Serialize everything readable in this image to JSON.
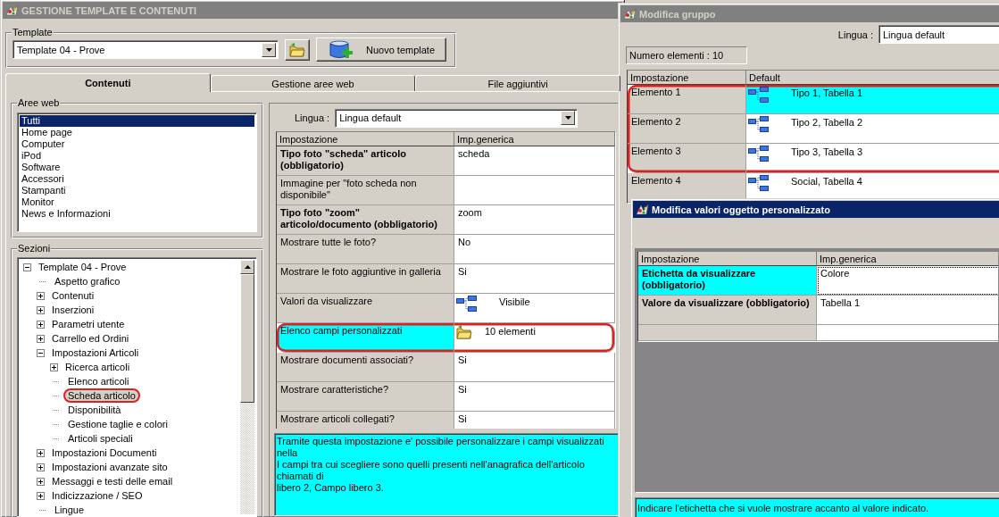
{
  "main_window": {
    "title": "GESTIONE TEMPLATE E CONTENUTI",
    "active": false,
    "template": {
      "label": "Template",
      "value": "Template 04 - Prove"
    },
    "new_template_button": "Nuovo template",
    "tabs": [
      {
        "label": "Contenuti",
        "selected": true
      },
      {
        "label": "Gestione aree web",
        "selected": false
      },
      {
        "label": "File aggiuntivi",
        "selected": false
      }
    ],
    "aree_web": {
      "label": "Aree web",
      "items": [
        {
          "label": "Tutti",
          "selected": true
        },
        {
          "label": "Home page",
          "selected": false
        },
        {
          "label": "Computer",
          "selected": false
        },
        {
          "label": "iPod",
          "selected": false
        },
        {
          "label": "Software",
          "selected": false
        },
        {
          "label": "Accessori",
          "selected": false
        },
        {
          "label": "Stampanti",
          "selected": false
        },
        {
          "label": "Monitor",
          "selected": false
        },
        {
          "label": "News e Informazioni",
          "selected": false
        }
      ]
    },
    "sezioni": {
      "label": "Sezioni",
      "tree": [
        {
          "label": "Template 04 - Prove",
          "kind": "expanded",
          "selected": false,
          "highlighted": false,
          "children": [
            {
              "label": "Aspetto grafico",
              "kind": "leaf",
              "selected": false,
              "highlighted": false
            },
            {
              "label": "Contenuti",
              "kind": "collapsed",
              "selected": false,
              "highlighted": false
            },
            {
              "label": "Inserzioni",
              "kind": "collapsed",
              "selected": false,
              "highlighted": false
            },
            {
              "label": "Parametri utente",
              "kind": "collapsed",
              "selected": false,
              "highlighted": false
            },
            {
              "label": "Carrello ed Ordini",
              "kind": "collapsed",
              "selected": false,
              "highlighted": false
            },
            {
              "label": "Impostazioni Articoli",
              "kind": "expanded",
              "selected": false,
              "highlighted": false,
              "children": [
                {
                  "label": "Ricerca articoli",
                  "kind": "collapsed",
                  "selected": false,
                  "highlighted": false
                },
                {
                  "label": "Elenco articoli",
                  "kind": "leaf",
                  "selected": false,
                  "highlighted": false
                },
                {
                  "label": "Scheda articolo",
                  "kind": "leaf",
                  "selected": true,
                  "highlighted": true
                },
                {
                  "label": "Disponibilità",
                  "kind": "leaf",
                  "selected": false,
                  "highlighted": false
                },
                {
                  "label": "Gestione taglie e colori",
                  "kind": "leaf",
                  "selected": false,
                  "highlighted": false
                },
                {
                  "label": "Articoli speciali",
                  "kind": "leaf",
                  "selected": false,
                  "highlighted": false
                }
              ]
            },
            {
              "label": "Impostazioni Documenti",
              "kind": "collapsed",
              "selected": false,
              "highlighted": false
            },
            {
              "label": "Impostazioni avanzate sito",
              "kind": "collapsed",
              "selected": false,
              "highlighted": false
            },
            {
              "label": "Messaggi e testi delle email",
              "kind": "collapsed",
              "selected": false,
              "highlighted": false
            },
            {
              "label": "Indicizzazione / SEO",
              "kind": "collapsed",
              "selected": false,
              "highlighted": false
            },
            {
              "label": "Lingue",
              "kind": "leaf",
              "selected": false,
              "highlighted": false
            }
          ]
        }
      ]
    },
    "lingua": {
      "label": "Lingua :",
      "value": "Lingua default"
    },
    "settings": {
      "columns": [
        "Impostazione",
        "Imp.generica"
      ],
      "rows": [
        {
          "label": "Tipo foto \"scheda\" articolo (obbligatorio)",
          "bold": true,
          "selected": false,
          "highlighted": false,
          "kind": "text",
          "value": "scheda"
        },
        {
          "label": "Immagine per \"foto scheda non disponibile\"",
          "bold": false,
          "selected": false,
          "highlighted": false,
          "kind": "text"
        },
        {
          "label": "Tipo foto \"zoom\" articolo/documento (obbligatorio)",
          "bold": true,
          "selected": false,
          "highlighted": false,
          "kind": "text",
          "value": "zoom"
        },
        {
          "label": "Mostrare tutte le foto?",
          "bold": false,
          "selected": false,
          "highlighted": false,
          "kind": "text",
          "value": "No"
        },
        {
          "label": "Mostrare le foto aggiuntive in galleria",
          "bold": false,
          "selected": false,
          "highlighted": false,
          "kind": "text",
          "value": "Si"
        },
        {
          "label": "Valori da visualizzare",
          "bold": false,
          "selected": false,
          "highlighted": false,
          "kind": "tree",
          "value": "Visibile"
        },
        {
          "label": "Elenco campi personalizzati",
          "bold": false,
          "selected": true,
          "highlighted": true,
          "kind": "folder",
          "value": "10 elementi"
        },
        {
          "label": "Mostrare documenti associati?",
          "bold": false,
          "selected": false,
          "highlighted": false,
          "kind": "text",
          "value": "Si"
        },
        {
          "label": "Mostrare caratteristiche?",
          "bold": false,
          "selected": false,
          "highlighted": false,
          "kind": "text",
          "value": "Si"
        },
        {
          "label": "Mostrare articoli collegati?",
          "bold": false,
          "selected": false,
          "highlighted": false,
          "kind": "text",
          "value": "Si"
        }
      ]
    },
    "description": [
      "Tramite questa impostazione e' possibile personalizzare i campi visualizzati nella",
      "I campi tra cui scegliere sono quelli presenti nell'anagrafica dell'articolo chiamati di",
      "libero 2, Campo libero 3."
    ]
  },
  "group_window": {
    "title": "Modifica gruppo",
    "active": false,
    "lingua": {
      "label": "Lingua :",
      "value": "Lingua default"
    },
    "count": "Numero elementi : 10",
    "table": {
      "columns": [
        "Impostazione",
        "Default"
      ],
      "rows": [
        {
          "label": "Elemento 1",
          "bold": false,
          "selected": true,
          "highlighted": true,
          "kind": "tree",
          "value": "Tipo 1, Tabella 1"
        },
        {
          "label": "Elemento 2",
          "bold": false,
          "selected": false,
          "highlighted": true,
          "kind": "tree",
          "value": "Tipo 2, Tabella 2"
        },
        {
          "label": "Elemento 3",
          "bold": false,
          "selected": false,
          "highlighted": true,
          "kind": "tree",
          "value": "Tipo 3, Tabella 3"
        },
        {
          "label": "Elemento 4",
          "bold": false,
          "selected": false,
          "highlighted": false,
          "kind": "tree",
          "value": "Social, Tabella 4"
        }
      ]
    }
  },
  "values_window": {
    "title": "Modifica valori oggetto personalizzato",
    "active": true,
    "table": {
      "columns": [
        "Impostazione",
        "Imp.generica"
      ],
      "rows": [
        {
          "label": "Etichetta da visualizzare (obbligatorio)",
          "bold": true,
          "selected": true,
          "focused": true,
          "kind": "text",
          "value": "Colore"
        },
        {
          "label": "Valore da visualizzare (obbligatorio)",
          "bold": true,
          "selected": false,
          "focused": false,
          "kind": "text",
          "value": "Tabella 1"
        }
      ]
    },
    "description": [
      "Indicare l'etichetta che si vuole mostrare accanto al valore indicato."
    ]
  }
}
